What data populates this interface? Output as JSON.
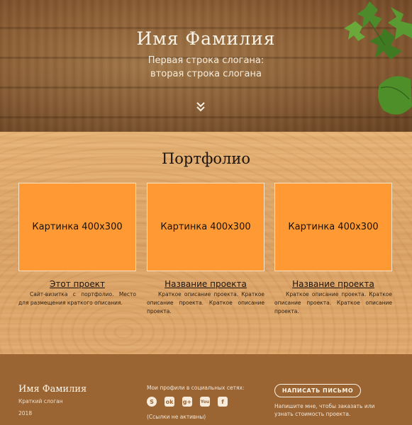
{
  "hero": {
    "title": "Имя Фамилия",
    "slogan_line1": "Первая строка слогана:",
    "slogan_line2": "вторая строка слогана",
    "scroll_icon": "double-chevron-down-icon"
  },
  "portfolio": {
    "heading": "Портфолио",
    "cards": [
      {
        "image_label": "Картинка 400x300",
        "title": "Этот проект",
        "description": "Сайт-визитка с портфолио. Место для размещения краткого описания."
      },
      {
        "image_label": "Картинка 400x300",
        "title": "Название проекта",
        "description": "Краткое описание проекта. Краткое описание проекта. Краткое описание проекта."
      },
      {
        "image_label": "Картинка 400x300",
        "title": "Название проекта",
        "description": "Краткое описание проекта. Краткое описание проекта. Краткое описание проекта."
      }
    ]
  },
  "footer": {
    "name": "Имя Фамилия",
    "slogan": "Краткий слоган",
    "year": "2018",
    "social_label": "Мои профили в социальных сетях:",
    "social_icons": [
      {
        "name": "skype-icon",
        "glyph": "S"
      },
      {
        "name": "odnoklassniki-icon",
        "glyph": "ok"
      },
      {
        "name": "google-plus-icon",
        "glyph": "g+"
      },
      {
        "name": "youtube-icon",
        "glyph": "You"
      },
      {
        "name": "facebook-icon",
        "glyph": "f"
      }
    ],
    "links_note": "(Ссылки не активны)",
    "write_button": "НАПИСАТЬ ПИСЬМО",
    "write_note": "Напишите мне, чтобы заказать или узнать стоимость проекта."
  },
  "colors": {
    "card_orange": "#ff9933",
    "footer_brown": "#9a6433",
    "text_dark": "#1d150d"
  }
}
